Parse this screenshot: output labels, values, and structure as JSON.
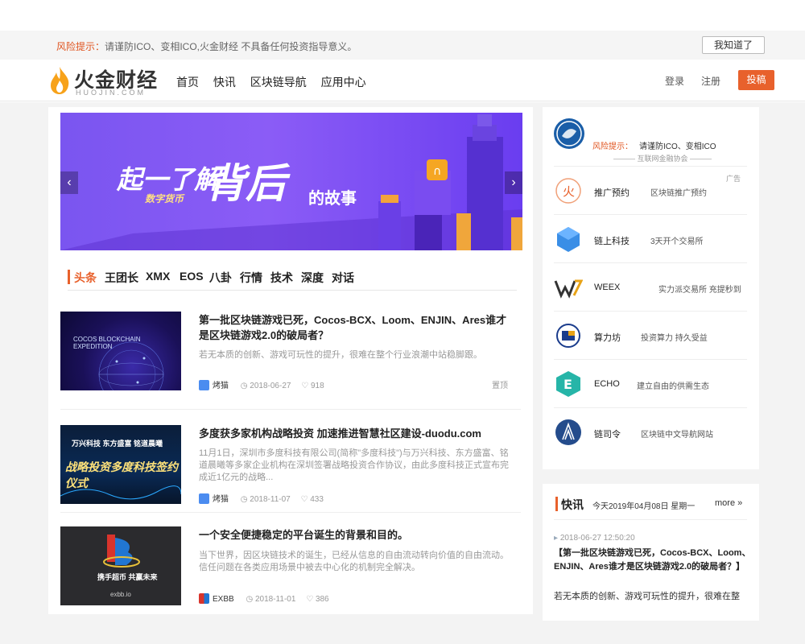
{
  "notice": {
    "label": "风险提示：",
    "text": "请谨防ICO、变相ICO,火金财经 不具备任何投资指导意义。",
    "dismiss_button": "我知道了"
  },
  "header": {
    "logo_text": "火金财经",
    "logo_pinyin": "HUOJIN.COM",
    "nav": [
      "首页",
      "快讯",
      "区块链导航",
      "应用中心"
    ],
    "login": "登录",
    "register": "注册",
    "post": "投稿"
  },
  "banner": {
    "line1": "一了解",
    "line1_prefix": "起",
    "big": "背后",
    "suffix": "的故事",
    "sub": "数字货币"
  },
  "tabs": [
    "头条",
    "王团长",
    "XMX",
    "EOS",
    "八卦",
    "行情",
    "技术",
    "深度",
    "对话"
  ],
  "articles": [
    {
      "title": "第一批区块链游戏已死，Cocos-BCX、Loom、ENJIN、Ares谁才是区块链游戏2.0的破局者？",
      "desc": "若无本质的创新、游戏可玩性的提升，很难在整个行业浪潮中站稳脚跟。",
      "author": "烤猫",
      "date": "2018-06-27",
      "likes": "918",
      "tag": "置顶",
      "thumb_text": "COCOS BLOCKCHAIN EXPEDITION"
    },
    {
      "title": "多度获多家机构战略投资 加速推进智慧社区建设-duodu.com",
      "desc": "11月1日，深圳市多度科技有限公司(简称\"多度科技\")与万兴科技、东方盛富、铭道晨曦等多家企业机构在深圳签署战略投资合作协议，由此多度科技正式宣布完成近1亿元的战略...",
      "author": "烤猫",
      "date": "2018-11-07",
      "likes": "433",
      "thumb_text_1": "万兴科技  东方盛富  铭道晨曦",
      "thumb_text_2": "战略投资多度科技签约仪式"
    },
    {
      "title": "一个安全便捷稳定的平台诞生的背景和目的。",
      "desc": "当下世界，因区块链技术的诞生，已经从信息的自由流动转向价值的自由流动。信任问题在各类应用场景中被去中心化的机制完全解决。",
      "author": "EXBB",
      "date": "2018-11-01",
      "likes": "386",
      "thumb_text_1": "携手超币 共赢未来",
      "thumb_text_2": "exbb.io"
    }
  ],
  "sidebar": {
    "risk_label": "风险提示：",
    "risk_text": "请谨防ICO、变相ICO",
    "risk_sub": "——— 互联网金融协会 ———",
    "ad_tag": "广告",
    "items": [
      {
        "name": "推广预约",
        "desc": "区块链推广预约"
      },
      {
        "name": "链上科技",
        "desc": "3天开个交易所"
      },
      {
        "name": "WEEX",
        "desc": "实力派交易所 充提秒到"
      },
      {
        "name": "算力坊",
        "desc": "投资算力 持久受益"
      },
      {
        "name": "ECHO",
        "desc": "建立自由的供需生态"
      },
      {
        "name": "链司令",
        "desc": "区块链中文导航网站"
      }
    ]
  },
  "flash": {
    "heading": "快讯",
    "date": "今天2019年04月08日 星期一",
    "more": "more »",
    "time": "2018-06-27 12:50:20",
    "title": "【第一批区块链游戏已死，Cocos-BCX、Loom、ENJIN、Ares谁才是区块链游戏2.0的破局者？】",
    "desc": "若无本质的创新、游戏可玩性的提升，很难在整"
  }
}
